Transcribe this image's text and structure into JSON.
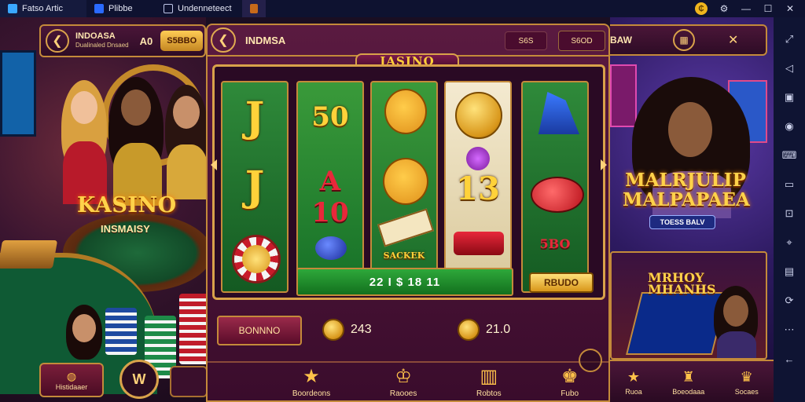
{
  "emulator": {
    "tabs": [
      {
        "label": "Fatso Artic",
        "icon": "home-icon"
      },
      {
        "label": "Plibbe",
        "icon": "app-icon"
      },
      {
        "label": "Undenneteect",
        "icon": "game-controller-icon"
      },
      {
        "label": "",
        "icon": "game-thumbnail-icon"
      }
    ],
    "controls": [
      "coin-icon",
      "settings-icon",
      "minimize-icon",
      "maximize-icon",
      "close-icon"
    ],
    "sidebar_tools": [
      "expand-icon",
      "volume-icon",
      "screenshot-icon",
      "record-icon",
      "keyboard-icon",
      "gamepad-icon",
      "shake-icon",
      "location-icon",
      "folder-icon",
      "rotate-icon",
      "more-icon",
      "back-icon"
    ]
  },
  "left_scene": {
    "header_title": "INDOASA",
    "header_subtitle": "Dualinaled Dnsaed",
    "header_number": "A0",
    "header_pill": "S5BBO",
    "logo_title": "KASINO",
    "logo_subtitle": "INSMAISY",
    "button_text": "Histidaaer",
    "round_button": "W"
  },
  "game_panel": {
    "title": "INDMSA",
    "button1": "S6S",
    "button2": "S6OD",
    "reel_banner": "IASINO",
    "reels": [
      [
        "J",
        "J",
        "coin"
      ],
      [
        "50",
        "A 10",
        "ball"
      ],
      [
        "cat",
        "face",
        "SACKEK"
      ],
      [
        "coin",
        "13",
        "sack"
      ],
      [
        "hat",
        "gem",
        "5BO"
      ]
    ],
    "win_display": "22 I $ 18 11",
    "spin_label": "RBUDO",
    "bonus_button": "BONNNO",
    "balance1": "243",
    "balance2": "21.0",
    "nav": [
      {
        "label": "Boordeons",
        "icon": "star-icon"
      },
      {
        "label": "Raooes",
        "icon": "trophy-icon"
      },
      {
        "label": "Robtos",
        "icon": "slot-machine-icon"
      },
      {
        "label": "Fubo",
        "icon": "gift-icon"
      }
    ]
  },
  "right_scene": {
    "header_title": "BAW",
    "promo_title_1": "MALRJULIP",
    "promo_title_2": "MALPAPAEA",
    "promo_badge": "TOESS BALV",
    "mini_title_1": "MRHOY",
    "mini_title_2": "MHANHS",
    "nav": [
      {
        "label": "Ruoa",
        "icon": "star-icon"
      },
      {
        "label": "Boeodaaa",
        "icon": "castle-icon"
      },
      {
        "label": "Socaes",
        "icon": "crown-icon"
      }
    ]
  }
}
